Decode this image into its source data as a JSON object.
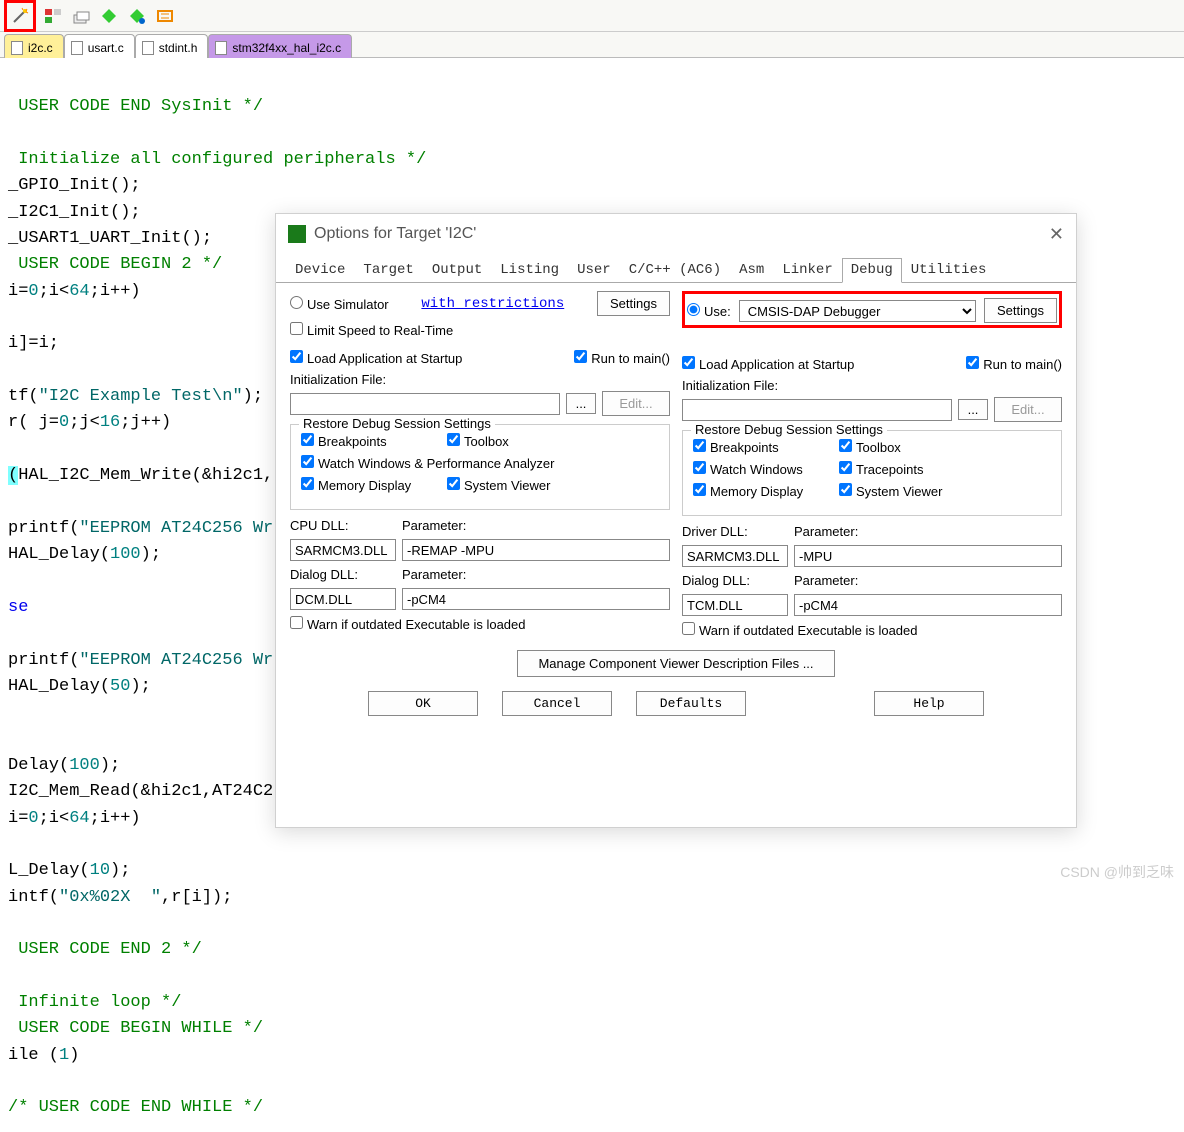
{
  "tabs": {
    "t1": "i2c.c",
    "t2": "usart.c",
    "t3": "stdint.h",
    "t4": "stm32f4xx_hal_i2c.c"
  },
  "code": {
    "l1": " USER CODE END SysInit */",
    "l2": " Initialize all configured peripherals */",
    "l3a": "_GPIO_Init",
    "l3b": "();",
    "l4a": "_I2C1_Init",
    "l4b": "();",
    "l5a": "_USART1_UART_Init",
    "l5b": "();",
    "l6": " USER CODE BEGIN 2 */",
    "l7a": "i=",
    "l7b": "0",
    "l7c": ";i<",
    "l7d": "64",
    "l7e": ";i++)",
    "l8": "i]=i;",
    "l9a": "tf(",
    "l9b": "\"I2C Example Test\\n\"",
    "l9c": ");",
    "l10a": "r( j=",
    "l10b": "0",
    "l10c": ";j<",
    "l10d": "16",
    "l10e": ";j++)",
    "l11a": "(",
    "l11b": "HAL_I2C_Mem_Write",
    "l11c": "(&hi2c1,",
    "l12a": "printf(",
    "l12b": "\"EEPROM AT24C256 Wr",
    "l13a": "HAL_Delay",
    "l13b": "(",
    "l13c": "100",
    "l13d": ");",
    "l14": "se",
    "l15a": "printf(",
    "l15b": "\"EEPROM AT24C256 Wr",
    "l16a": "HAL_Delay",
    "l16b": "(",
    "l16c": "50",
    "l16d": ");",
    "l17a": "Delay(",
    "l17b": "100",
    "l17c": ");",
    "l18a": "I2C_Mem_Read",
    "l18b": "(&hi2c1,AT24C2",
    "l19a": "i=",
    "l19b": "0",
    "l19c": ";i<",
    "l19d": "64",
    "l19e": ";i++)",
    "l20a": "L_Delay(",
    "l20b": "10",
    "l20c": ");",
    "l21a": "intf(",
    "l21b": "\"0x%02X  \"",
    "l21c": ",r[i]);",
    "l22": " USER CODE END 2 */",
    "l23": " Infinite loop */",
    "l24": " USER CODE BEGIN WHILE */",
    "l25a": "ile (",
    "l25b": "1",
    "l25c": ")",
    "l26": "/* USER CODE END WHILE */"
  },
  "dialog": {
    "title": "Options for Target 'I2C'",
    "tabs": {
      "device": "Device",
      "target": "Target",
      "output": "Output",
      "listing": "Listing",
      "user": "User",
      "cc": "C/C++ (AC6)",
      "asm": "Asm",
      "linker": "Linker",
      "debug": "Debug",
      "utilities": "Utilities"
    },
    "left": {
      "useSim": "Use Simulator",
      "restrictions": "with restrictions",
      "settings": "Settings",
      "limitSpeed": "Limit Speed to Real-Time",
      "loadApp": "Load Application at Startup",
      "runMain": "Run to main()",
      "initFile": "Initialization File:",
      "browse": "...",
      "edit": "Edit...",
      "restoreTitle": "Restore Debug Session Settings",
      "bp": "Breakpoints",
      "toolbox": "Toolbox",
      "watch": "Watch Windows & Performance Analyzer",
      "mem": "Memory Display",
      "sysview": "System Viewer",
      "cpuDll": "CPU DLL:",
      "param": "Parameter:",
      "cpuDllVal": "SARMCM3.DLL",
      "cpuParamVal": "-REMAP -MPU",
      "dlgDll": "Dialog DLL:",
      "dlgDllVal": "DCM.DLL",
      "dlgParamVal": "-pCM4",
      "warn": "Warn if outdated Executable is loaded"
    },
    "right": {
      "use": "Use:",
      "debugger": "CMSIS-DAP Debugger",
      "settings": "Settings",
      "loadApp": "Load Application at Startup",
      "runMain": "Run to main()",
      "initFile": "Initialization File:",
      "browse": "...",
      "edit": "Edit...",
      "restoreTitle": "Restore Debug Session Settings",
      "bp": "Breakpoints",
      "toolbox": "Toolbox",
      "watch": "Watch Windows",
      "trace": "Tracepoints",
      "mem": "Memory Display",
      "sysview": "System Viewer",
      "drvDll": "Driver DLL:",
      "param": "Parameter:",
      "drvDllVal": "SARMCM3.DLL",
      "drvParamVal": "-MPU",
      "dlgDll": "Dialog DLL:",
      "dlgDllVal": "TCM.DLL",
      "dlgParamVal": "-pCM4",
      "warn": "Warn if outdated Executable is loaded"
    },
    "manage": "Manage Component Viewer Description Files ...",
    "ok": "OK",
    "cancel": "Cancel",
    "defaults": "Defaults",
    "help": "Help"
  },
  "watermark": "CSDN @帅到乏味"
}
